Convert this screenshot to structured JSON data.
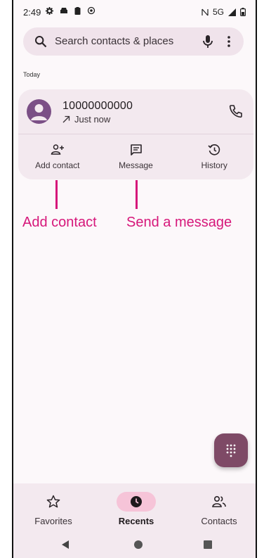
{
  "status_bar": {
    "time": "2:49",
    "network": "5G"
  },
  "search": {
    "placeholder": "Search contacts & places"
  },
  "section": {
    "label": "Today"
  },
  "call_entry": {
    "number": "10000000000",
    "status": "Just now",
    "call_type_icon": "outgoing-arrow-icon"
  },
  "actions": [
    {
      "label": "Add contact",
      "icon": "add-person-icon"
    },
    {
      "label": "Message",
      "icon": "message-icon"
    },
    {
      "label": "History",
      "icon": "history-icon"
    }
  ],
  "annotations": {
    "add_contact": "Add contact",
    "send_message": "Send a message",
    "color": "#d6177a"
  },
  "bottom_nav": [
    {
      "label": "Favorites",
      "icon": "star-icon",
      "active": false
    },
    {
      "label": "Recents",
      "icon": "clock-icon",
      "active": true
    },
    {
      "label": "Contacts",
      "icon": "people-icon",
      "active": false
    }
  ],
  "colors": {
    "background": "#fcf8fa",
    "search_bar": "#f0e3eb",
    "card": "#f3e9ef",
    "avatar": "#7b4f86",
    "fab": "#7e4a66",
    "nav_active_pill": "#f6c4d8"
  }
}
